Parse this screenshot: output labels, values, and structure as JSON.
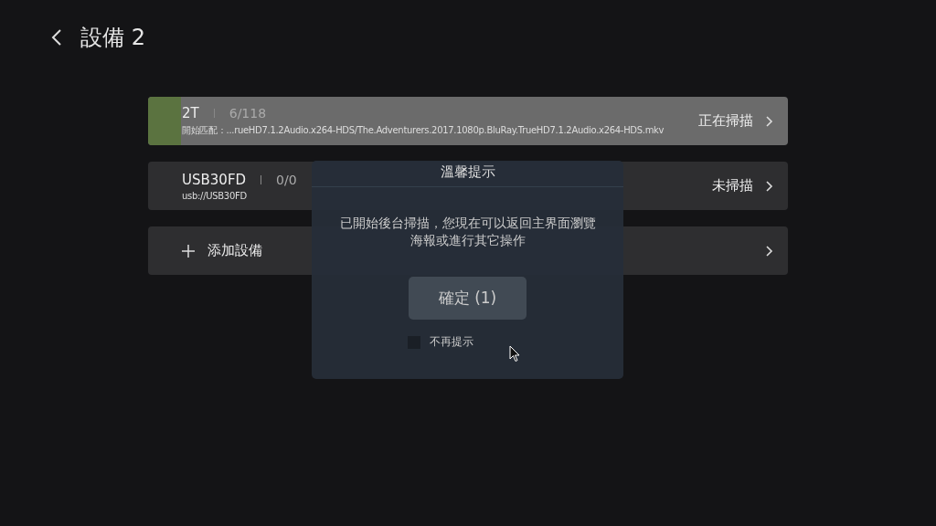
{
  "header": {
    "title": "設備 2"
  },
  "devices": [
    {
      "kind": "device",
      "name": "2T",
      "count": "6/118",
      "detail": "開始匹配：...rueHD7.1.2Audio.x264-HDS/The.Adventurers.2017.1080p.BluRay.TrueHD7.1.2Audio.x264-HDS.mkv",
      "status": "正在掃描",
      "selected": true,
      "level": 0.051
    },
    {
      "kind": "device",
      "name": "USB30FD",
      "count": "0/0",
      "detail": "usb://USB30FD",
      "status": "未掃描",
      "selected": false
    },
    {
      "kind": "add",
      "name": "添加設備",
      "selected": false
    }
  ],
  "dialog": {
    "title": "溫馨提示",
    "message": "已開始後台掃描，您現在可以返回主界面瀏覽海報或進行其它操作",
    "button": "確定 (1)",
    "checkbox": {
      "label": "不再提示",
      "checked": false
    }
  }
}
